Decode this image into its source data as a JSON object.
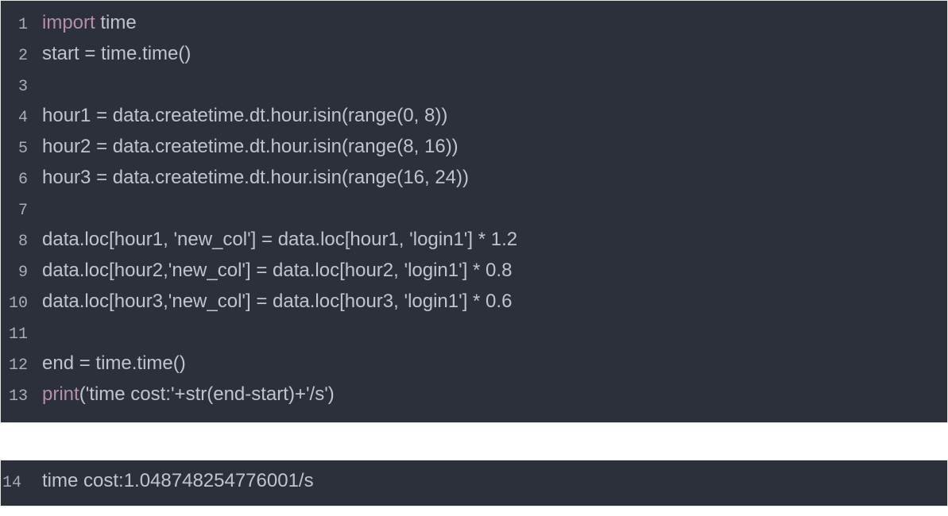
{
  "code_cell": {
    "lines": [
      {
        "no": "1",
        "tokens": [
          [
            "kw",
            "import"
          ],
          [
            "punc",
            " "
          ],
          [
            "id",
            "time"
          ]
        ]
      },
      {
        "no": "2",
        "tokens": [
          [
            "id",
            "start "
          ],
          [
            "op",
            "="
          ],
          [
            "id",
            " time.time()"
          ]
        ]
      },
      {
        "no": "3",
        "tokens": [
          [
            "blank",
            ""
          ]
        ]
      },
      {
        "no": "4",
        "tokens": [
          [
            "id",
            "hour1 "
          ],
          [
            "op",
            "="
          ],
          [
            "id",
            " data.createtime.dt.hour.isin(range("
          ],
          [
            "num",
            "0"
          ],
          [
            "id",
            ", "
          ],
          [
            "num",
            "8"
          ],
          [
            "id",
            "))"
          ]
        ]
      },
      {
        "no": "5",
        "tokens": [
          [
            "id",
            "hour2 "
          ],
          [
            "op",
            "="
          ],
          [
            "id",
            " data.createtime.dt.hour.isin(range("
          ],
          [
            "num",
            "8"
          ],
          [
            "id",
            ", "
          ],
          [
            "num",
            "16"
          ],
          [
            "id",
            "))"
          ]
        ]
      },
      {
        "no": "6",
        "tokens": [
          [
            "id",
            "hour3 "
          ],
          [
            "op",
            "="
          ],
          [
            "id",
            " data.createtime.dt.hour.isin(range("
          ],
          [
            "num",
            "16"
          ],
          [
            "id",
            ", "
          ],
          [
            "num",
            "24"
          ],
          [
            "id",
            "))"
          ]
        ]
      },
      {
        "no": "7",
        "tokens": [
          [
            "blank",
            ""
          ]
        ]
      },
      {
        "no": "8",
        "tokens": [
          [
            "id",
            "data.loc[hour1, "
          ],
          [
            "strhl",
            "'new_col'"
          ],
          [
            "id",
            "] "
          ],
          [
            "op",
            "="
          ],
          [
            "id",
            " data.loc[hour1, "
          ],
          [
            "strhl",
            "'login1'"
          ],
          [
            "id",
            "] * "
          ],
          [
            "num",
            "1.2"
          ]
        ]
      },
      {
        "no": "9",
        "tokens": [
          [
            "id",
            "data.loc[hour2,"
          ],
          [
            "strhl",
            "'new_col'"
          ],
          [
            "id",
            "] "
          ],
          [
            "op",
            "="
          ],
          [
            "id",
            " data.loc[hour2, "
          ],
          [
            "strhl",
            "'login1'"
          ],
          [
            "id",
            "] * "
          ],
          [
            "num",
            "0.8"
          ]
        ]
      },
      {
        "no": "10",
        "tokens": [
          [
            "id",
            "data.loc[hour3,"
          ],
          [
            "strhl",
            "'new_col'"
          ],
          [
            "id",
            "] "
          ],
          [
            "op",
            "="
          ],
          [
            "id",
            " data.loc[hour3, "
          ],
          [
            "strhl",
            "'login1'"
          ],
          [
            "id",
            "] * "
          ],
          [
            "num",
            "0.6"
          ]
        ]
      },
      {
        "no": "11",
        "tokens": [
          [
            "blank",
            ""
          ]
        ]
      },
      {
        "no": "12",
        "tokens": [
          [
            "id",
            "end "
          ],
          [
            "op",
            "="
          ],
          [
            "id",
            " time.time()"
          ]
        ]
      },
      {
        "no": "13",
        "tokens": [
          [
            "kw",
            "print"
          ],
          [
            "id",
            "("
          ],
          [
            "strhl",
            "'time cost:'"
          ],
          [
            "op",
            "+"
          ],
          [
            "id",
            "str(end"
          ],
          [
            "op",
            "-"
          ],
          [
            "id",
            "start)"
          ],
          [
            "op",
            "+"
          ],
          [
            "strhl",
            "'/s'"
          ],
          [
            "id",
            ")"
          ]
        ]
      }
    ]
  },
  "output_cell": {
    "lines": [
      {
        "no": "14",
        "text": "time cost:1.048748254776001/s"
      }
    ]
  }
}
